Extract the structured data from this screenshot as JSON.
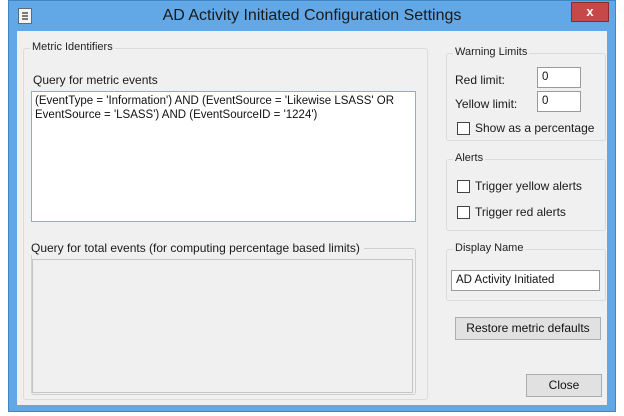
{
  "window": {
    "title": "AD Activity Initiated Configuration Settings",
    "close_glyph": "x"
  },
  "metric_identifiers": {
    "legend": "Metric Identifiers",
    "query_events_label": "Query for metric events",
    "query_events_value": "(EventType = 'Information') AND (EventSource = 'Likewise LSASS' OR EventSource = 'LSASS') AND (EventSourceID = '1224')",
    "query_total_label": "Query for total events (for computing percentage based limits)",
    "query_total_value": ""
  },
  "warning_limits": {
    "legend": "Warning Limits",
    "red_label": "Red limit:",
    "red_value": "0",
    "yellow_label": "Yellow limit:",
    "yellow_value": "0",
    "percentage_label": "Show as a percentage",
    "percentage_checked": false
  },
  "alerts": {
    "legend": "Alerts",
    "yellow_label": "Trigger yellow alerts",
    "yellow_checked": false,
    "red_label": "Trigger red alerts",
    "red_checked": false
  },
  "display_name": {
    "legend": "Display Name",
    "value": "AD Activity Initiated"
  },
  "buttons": {
    "restore": "Restore metric defaults",
    "close": "Close"
  },
  "icons": {
    "app": "window-app-icon",
    "close": "close-icon"
  }
}
